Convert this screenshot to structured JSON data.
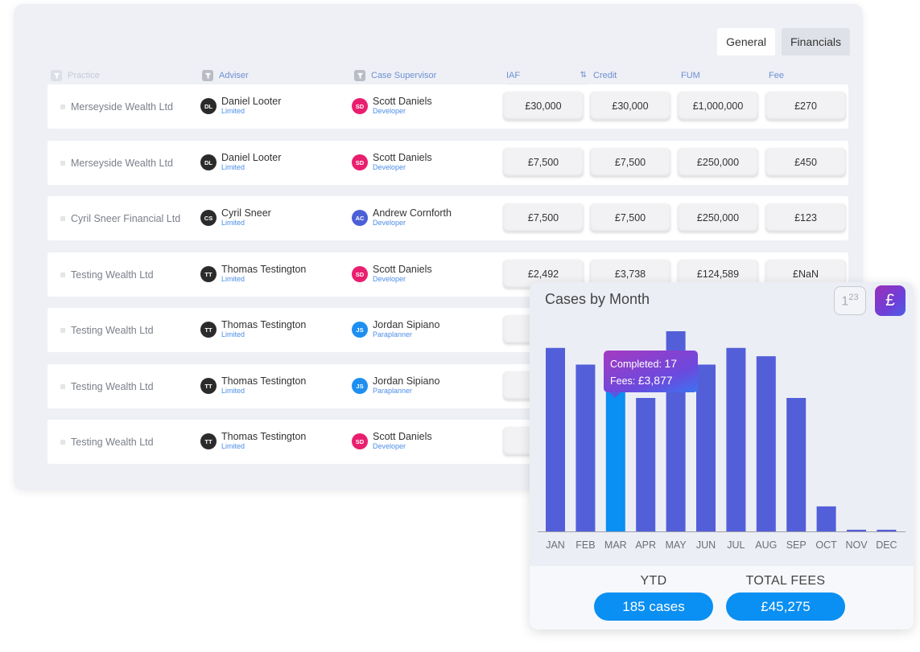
{
  "tabs": {
    "general": "General",
    "financials": "Financials"
  },
  "columns": {
    "practice": "Practice",
    "adviser": "Adviser",
    "supervisor": "Case Supervisor",
    "iaf": "IAF",
    "credit": "Credit",
    "fum": "FUM",
    "fee": "Fee"
  },
  "rows": [
    {
      "practice": "Merseyside Wealth Ltd",
      "adviser": {
        "initials": "DL",
        "name": "Daniel Looter",
        "role": "Limited",
        "color": "#2b2b2b"
      },
      "supervisor": {
        "initials": "SD",
        "name": "Scott Daniels",
        "role": "Developer",
        "color": "#ea1e6e"
      },
      "iaf": "£30,000",
      "credit": "£30,000",
      "fum": "£1,000,000",
      "fee": "£270"
    },
    {
      "practice": "Merseyside Wealth Ltd",
      "adviser": {
        "initials": "DL",
        "name": "Daniel Looter",
        "role": "Limited",
        "color": "#2b2b2b"
      },
      "supervisor": {
        "initials": "SD",
        "name": "Scott Daniels",
        "role": "Developer",
        "color": "#ea1e6e"
      },
      "iaf": "£7,500",
      "credit": "£7,500",
      "fum": "£250,000",
      "fee": "£450"
    },
    {
      "practice": "Cyril Sneer Financial Ltd",
      "adviser": {
        "initials": "CS",
        "name": "Cyril Sneer",
        "role": "Limited",
        "color": "#2b2b2b"
      },
      "supervisor": {
        "initials": "AC",
        "name": "Andrew Cornforth",
        "role": "Developer",
        "color": "#4b5fd6"
      },
      "iaf": "£7,500",
      "credit": "£7,500",
      "fum": "£250,000",
      "fee": "£123"
    },
    {
      "practice": "Testing Wealth Ltd",
      "adviser": {
        "initials": "TT",
        "name": "Thomas Testington",
        "role": "Limited",
        "color": "#2b2b2b"
      },
      "supervisor": {
        "initials": "SD",
        "name": "Scott Daniels",
        "role": "Developer",
        "color": "#ea1e6e"
      },
      "iaf": "£2,492",
      "credit": "£3,738",
      "fum": "£124,589",
      "fee": "£NaN"
    },
    {
      "practice": "Testing Wealth Ltd",
      "adviser": {
        "initials": "TT",
        "name": "Thomas Testington",
        "role": "Limited",
        "color": "#2b2b2b"
      },
      "supervisor": {
        "initials": "JS",
        "name": "Jordan Sipiano",
        "role": "Paraplanner",
        "color": "#1e8ff0"
      },
      "iaf": "",
      "credit": "",
      "fum": "",
      "fee": ""
    },
    {
      "practice": "Testing Wealth Ltd",
      "adviser": {
        "initials": "TT",
        "name": "Thomas Testington",
        "role": "Limited",
        "color": "#2b2b2b"
      },
      "supervisor": {
        "initials": "JS",
        "name": "Jordan Sipiano",
        "role": "Paraplanner",
        "color": "#1e8ff0"
      },
      "iaf": "",
      "credit": "",
      "fum": "",
      "fee": ""
    },
    {
      "practice": "Testing Wealth Ltd",
      "adviser": {
        "initials": "TT",
        "name": "Thomas Testington",
        "role": "Limited",
        "color": "#2b2b2b"
      },
      "supervisor": {
        "initials": "SD",
        "name": "Scott Daniels",
        "role": "Developer",
        "color": "#ea1e6e"
      },
      "iaf": "",
      "credit": "",
      "fum": "",
      "fee": ""
    }
  ],
  "chart_panel": {
    "title": "Cases by Month",
    "number_toggle": {
      "base": "1",
      "sup": "2",
      "sup2": "3"
    },
    "currency_toggle": "£",
    "tooltip": {
      "completed_label": "Completed:",
      "completed_value": "17",
      "fees_label": "Fees:",
      "fees_value": "£3,877"
    },
    "ytd_label": "YTD",
    "ytd_value": "185 cases",
    "total_fees_label": "TOTAL FEES",
    "total_fees_value": "£45,275"
  },
  "chart_data": {
    "type": "bar",
    "title": "Cases by Month",
    "categories": [
      "JAN",
      "FEB",
      "MAR",
      "APR",
      "MAY",
      "JUN",
      "JUL",
      "AUG",
      "SEP",
      "OCT",
      "NOV",
      "DEC"
    ],
    "values": [
      22,
      20,
      17,
      16,
      24,
      20,
      22,
      21,
      16,
      3,
      0.2,
      0.2
    ],
    "highlighted": "MAR",
    "ylim": [
      0,
      24
    ],
    "colors": {
      "bar": "#535fd9",
      "highlight": "#0a8ff2"
    }
  },
  "colors": {
    "accent_blue": "#0a8ff2",
    "bar": "#535fd9",
    "header_blue": "#6d8fd2"
  }
}
